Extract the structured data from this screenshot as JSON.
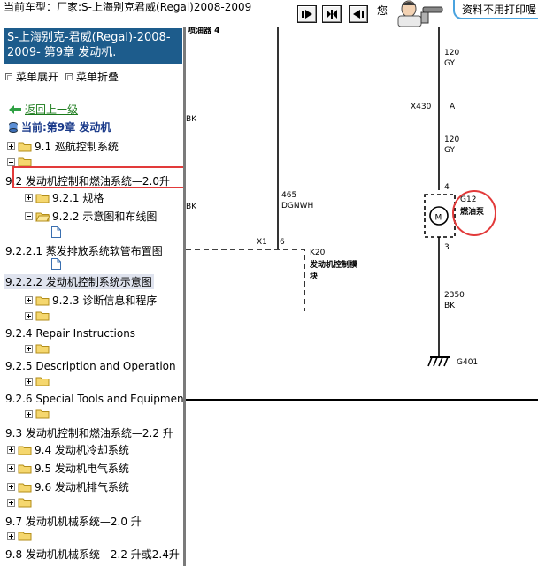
{
  "header": {
    "car_model_label": "当前车型：",
    "car_model_value": "厂家:S-上海别克君威(Regal)2008-2009",
    "greeting": "您",
    "bubble_text": "资料不用打印喔"
  },
  "sidebar": {
    "title": "S-上海别克-君威(Regal)-2008-2009- 第9章 发动机.",
    "expand_all": "菜单展开",
    "collapse_all": "菜单折叠",
    "back_link": "返回上一级",
    "current": "当前:第9章 发动机",
    "items": [
      {
        "label": "9.1 巡航控制系统"
      },
      {
        "label": ""
      },
      {
        "label": "9.2 发动机控制和燃油系统—2.0升"
      },
      {
        "label": "9.2.1 规格"
      },
      {
        "label": "9.2.2 示意图和布线图"
      },
      {
        "label": "9.2.2.1 蒸发排放系统软管布置图"
      },
      {
        "label": "9.2.2.2 发动机控制系统示意图"
      },
      {
        "label": "9.2.3 诊断信息和程序"
      },
      {
        "label": "9.2.4 Repair Instructions"
      },
      {
        "label": "9.2.5 Description and Operation"
      },
      {
        "label": "9.2.6 Special Tools and Equipment"
      },
      {
        "label": "9.3 发动机控制和燃油系统—2.2 升"
      },
      {
        "label": "9.4 发动机冷却系统"
      },
      {
        "label": "9.5 发动机电气系统"
      },
      {
        "label": "9.6 发动机排气系统"
      },
      {
        "label": "9.7 发动机机械系统—2.0 升"
      },
      {
        "label": "9.8 发动机机械系统—2.2 升或2.4升"
      }
    ]
  },
  "diagram": {
    "labels": {
      "injector": "喷油器 4",
      "bk_top": "BK",
      "bk_mid": "BK",
      "w465": "465",
      "dgnwh": "DGNWH",
      "x1": "X1",
      "pin6": "6",
      "k20": "K20",
      "k20_name_1": "发动机控制模",
      "k20_name_2": "块",
      "w120a": "120",
      "gy_a": "GY",
      "x430": "X430",
      "pin_a": "A",
      "w120b": "120",
      "gy_b": "GY",
      "pin4": "4",
      "g12": "G12",
      "pump": "燃油泵",
      "motor": "M",
      "pin3": "3",
      "w2350": "2350",
      "bk_low": "BK",
      "g401": "G401"
    },
    "colors": {
      "wire": "#000000",
      "highlight": "#e23a3a"
    }
  }
}
